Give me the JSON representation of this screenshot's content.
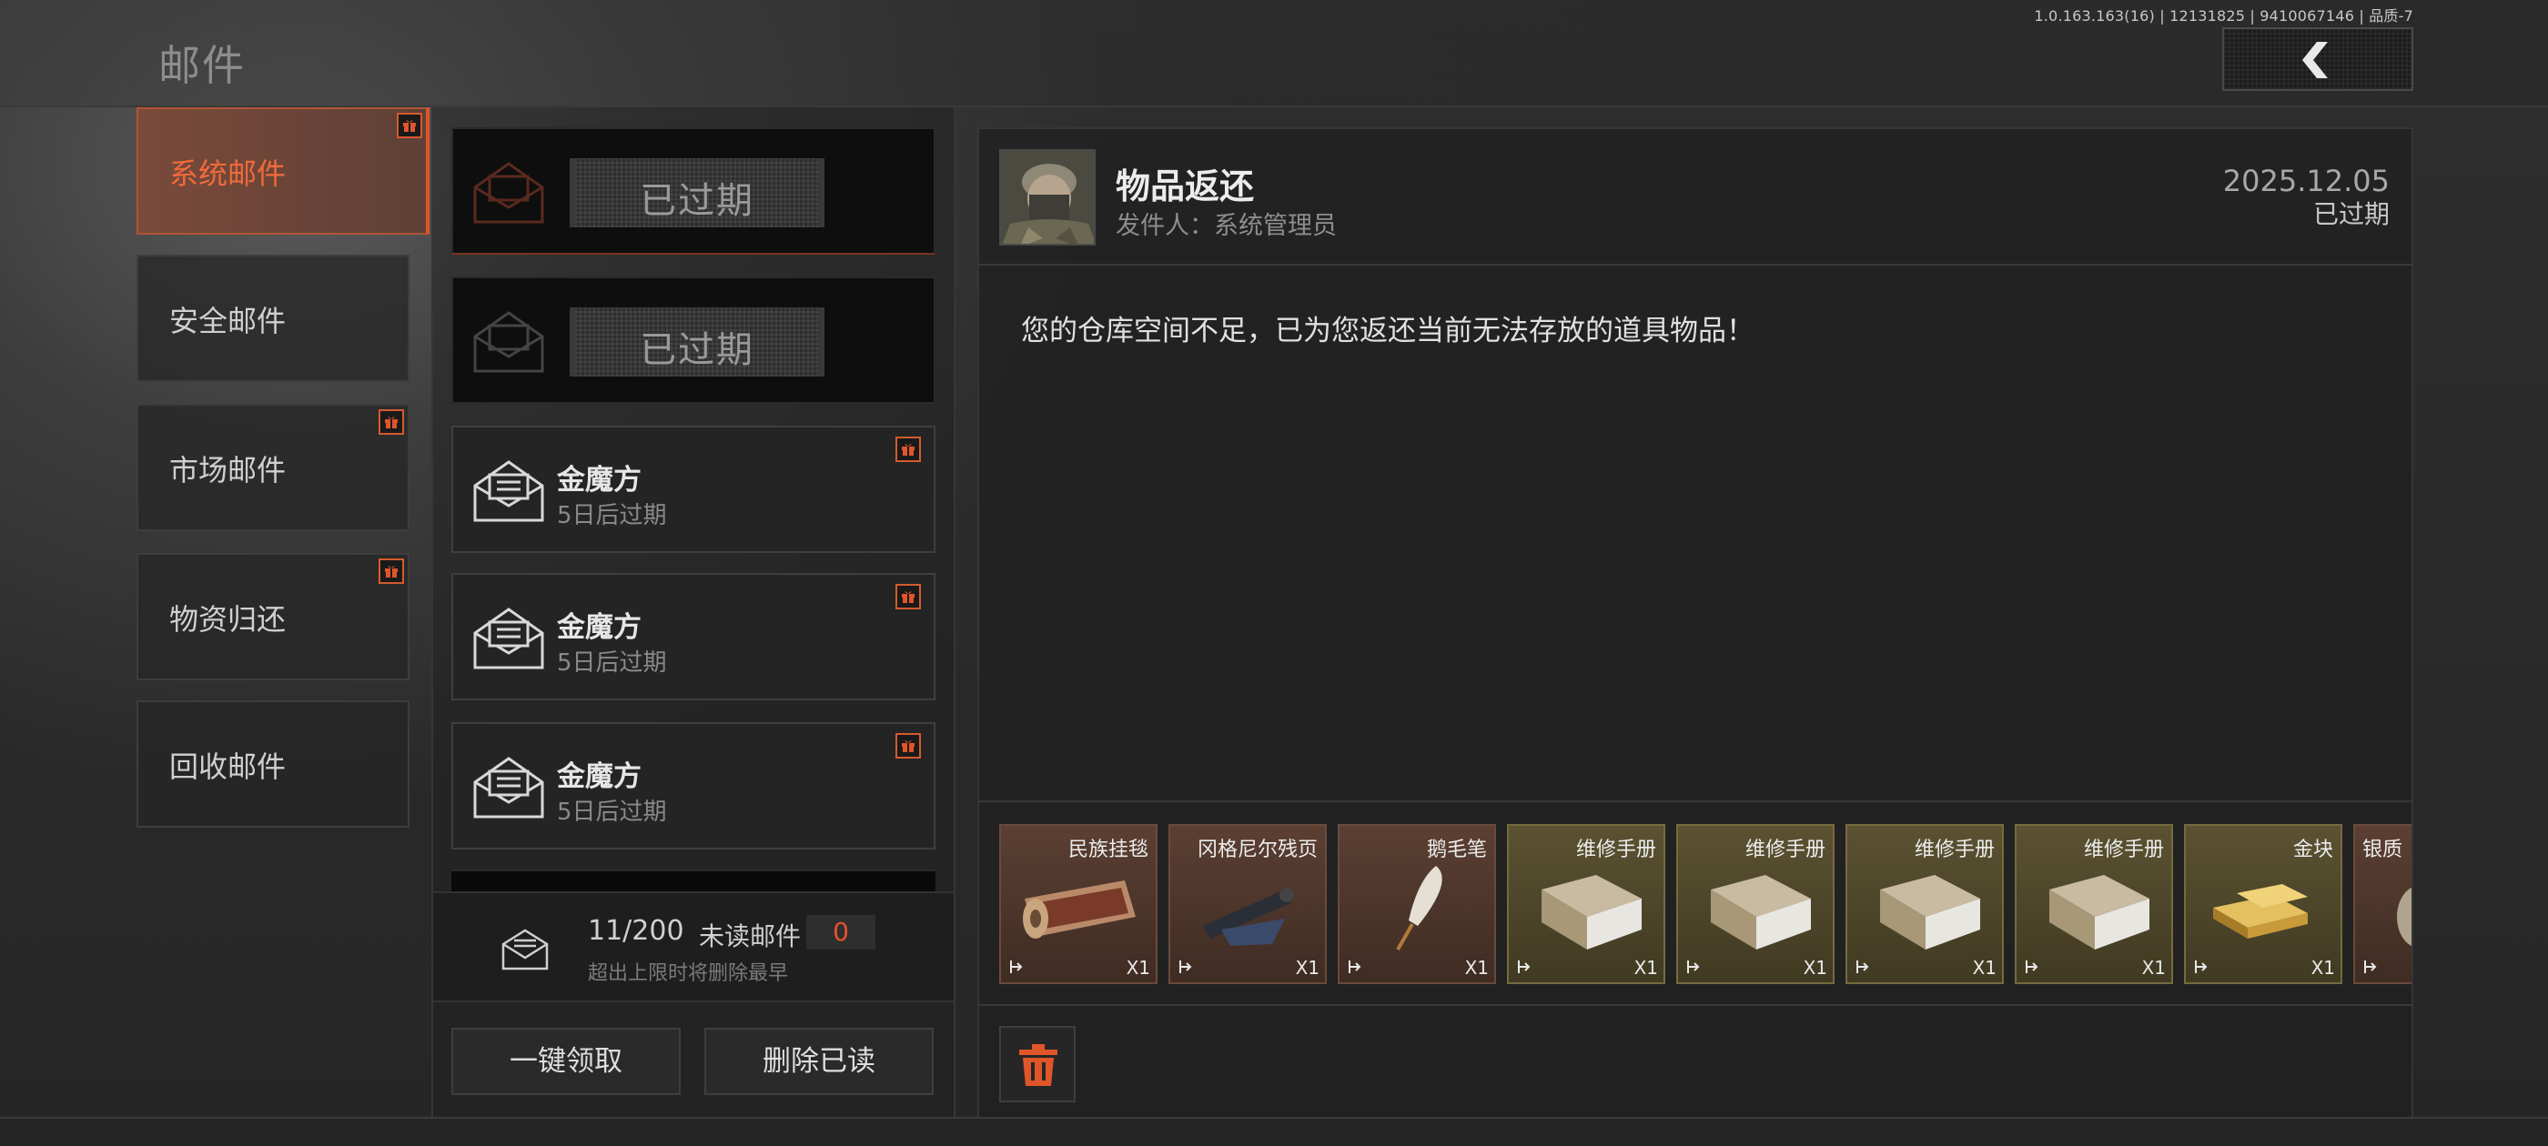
{
  "header": {
    "title": "邮件",
    "version": "1.0.163.163(16) | 12131825 | 9410067146 | 品质-7",
    "back_icon": "chevron-left-icon"
  },
  "categories": [
    {
      "label": "系统邮件",
      "active": true,
      "badge": true
    },
    {
      "label": "安全邮件",
      "active": false,
      "badge": false
    },
    {
      "label": "市场邮件",
      "active": false,
      "badge": true
    },
    {
      "label": "物资归还",
      "active": false,
      "badge": true
    },
    {
      "label": "回收邮件",
      "active": false,
      "badge": false
    }
  ],
  "mail_list": [
    {
      "title": "",
      "subtitle": "",
      "expired_label": "已过期",
      "expired": true,
      "selected": true
    },
    {
      "title": "",
      "subtitle": "",
      "expired_label": "已过期",
      "expired": true,
      "selected": false
    },
    {
      "title": "金魔方",
      "subtitle": "5日后过期",
      "expired": false,
      "badge": true
    },
    {
      "title": "金魔方",
      "subtitle": "5日后过期",
      "expired": false,
      "badge": true
    },
    {
      "title": "金魔方",
      "subtitle": "5日后过期",
      "expired": false,
      "badge": true
    }
  ],
  "mailbox": {
    "count": "11/200",
    "unread_label": "未读邮件",
    "unread_count": "0",
    "note": "超出上限时将删除最早"
  },
  "actions": {
    "claim_all": "一键领取",
    "delete_read": "删除已读"
  },
  "detail": {
    "subject": "物品返还",
    "sender": "发件人：系统管理员",
    "date": "2025.12.05",
    "status": "已过期",
    "body": "您的仓库空间不足，已为您返还当前无法存放的道具物品！",
    "rewards": [
      {
        "name": "民族挂毯",
        "qty": "X1",
        "rarity": "brown"
      },
      {
        "name": "冈格尼尔残页",
        "qty": "X1",
        "rarity": "brown"
      },
      {
        "name": "鹅毛笔",
        "qty": "X1",
        "rarity": "brown"
      },
      {
        "name": "维修手册",
        "qty": "X1",
        "rarity": "gold"
      },
      {
        "name": "维修手册",
        "qty": "X1",
        "rarity": "gold"
      },
      {
        "name": "维修手册",
        "qty": "X1",
        "rarity": "gold"
      },
      {
        "name": "维修手册",
        "qty": "X1",
        "rarity": "gold"
      },
      {
        "name": "金块",
        "qty": "X1",
        "rarity": "gold"
      },
      {
        "name": "银质",
        "qty": "",
        "rarity": "brown"
      }
    ]
  },
  "colors": {
    "accent": "#e0552a",
    "panel": "#212121",
    "text": "#d8d8d8"
  }
}
